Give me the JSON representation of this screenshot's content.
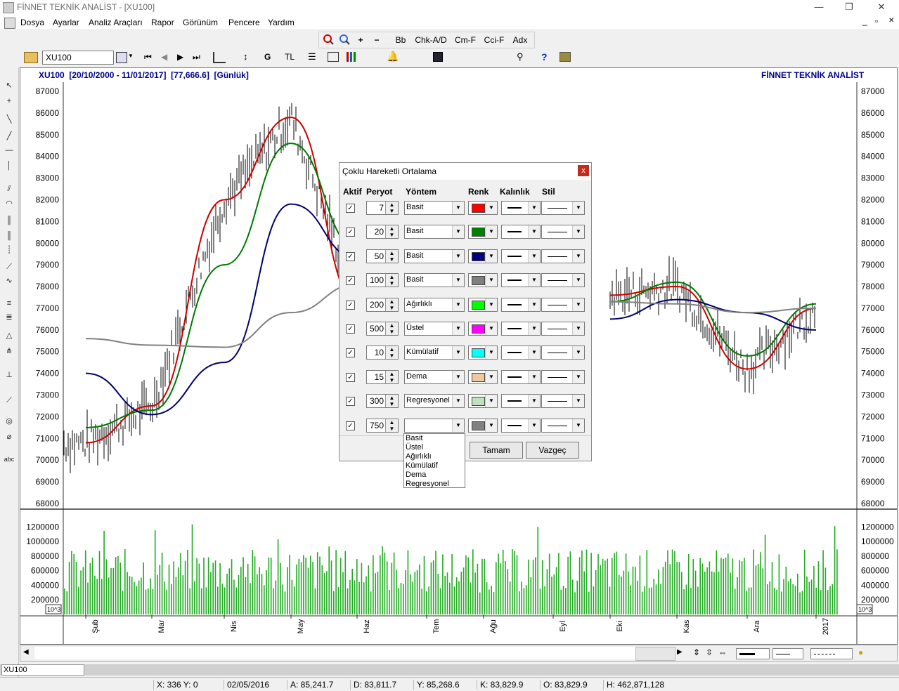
{
  "app": {
    "title": "FİNNET TEKNİK ANALİST - [XU100]"
  },
  "window_controls": {
    "minimize": "—",
    "maximize": "❐",
    "close": "✕",
    "mdi_minimize": "_",
    "mdi_restore": "▫",
    "mdi_close": "✕"
  },
  "menu": [
    "Dosya",
    "Ayarlar",
    "Analiz Araçları",
    "Rapor",
    "Görünüm",
    "Pencere",
    "Yardım"
  ],
  "toolbar1": {
    "zoom_in": "+",
    "zoom_out": "−",
    "add": "+",
    "remove": "−",
    "items": [
      "Bb",
      "Chk-A/D",
      "Cm-F",
      "Cci-F",
      "Adx"
    ]
  },
  "toolbar2": {
    "symbol": "XU100",
    "g_label": "G",
    "tl_label": "TL",
    "help": "?"
  },
  "chart": {
    "header_left": "XU100  [20/10/2000 - 11/01/2017]  [77,666.6]  [Günlük]",
    "header_right": "FİNNET TEKNİK ANALİST",
    "price_ticks": [
      "87000",
      "86000",
      "85000",
      "84000",
      "83000",
      "82000",
      "81000",
      "80000",
      "79000",
      "78000",
      "77000",
      "76000",
      "75000",
      "74000",
      "73000",
      "72000",
      "71000",
      "70000",
      "69000",
      "68000"
    ],
    "volume_ticks": [
      "1200000",
      "1000000",
      "800000",
      "600000",
      "400000",
      "200000"
    ],
    "volume_unit": "10^3",
    "months": [
      "Şub",
      "Mar",
      "Nis",
      "May",
      "Haz",
      "Tem",
      "Ağu",
      "Eyl",
      "Eki",
      "Kas",
      "Ara",
      "2017"
    ]
  },
  "chart_data": {
    "type": "line",
    "x": [
      "Şub",
      "Mar",
      "Nis",
      "May",
      "Haz",
      "Tem",
      "Ağu",
      "Eyl",
      "Eki",
      "Kas",
      "Ara",
      "2017"
    ],
    "ylim": [
      68000,
      87000
    ],
    "series": [
      {
        "name": "7",
        "color": "#d00000",
        "values": [
          70800,
          72500,
          82000,
          85800,
          77300,
          null,
          null,
          null,
          77600,
          78000,
          74200,
          77000
        ]
      },
      {
        "name": "20",
        "color": "#007800",
        "values": [
          71500,
          72300,
          79000,
          84600,
          79800,
          null,
          null,
          null,
          77300,
          78200,
          74800,
          77200
        ]
      },
      {
        "name": "50",
        "color": "#000070",
        "values": [
          74000,
          72100,
          74500,
          81800,
          79300,
          null,
          null,
          null,
          76500,
          77400,
          76800,
          76000
        ]
      },
      {
        "name": "100",
        "color": "#808080",
        "values": [
          75600,
          75300,
          75200,
          76800,
          78100,
          null,
          null,
          null,
          77300,
          77200,
          76800,
          77000
        ]
      }
    ],
    "volume_ylim": [
      0,
      1300000
    ]
  },
  "dialog": {
    "title": "Çoklu Hareketli Ortalama",
    "close": "x",
    "headers": {
      "aktif": "Aktif",
      "peryot": "Peryot",
      "yontem": "Yöntem",
      "renk": "Renk",
      "kalinlik": "Kalınlık",
      "stil": "Stil"
    },
    "rows": [
      {
        "checked": "✓",
        "period": "7",
        "method": "Basit",
        "color": "#ff0000"
      },
      {
        "checked": "✓",
        "period": "20",
        "method": "Basit",
        "color": "#008000"
      },
      {
        "checked": "✓",
        "period": "50",
        "method": "Basit",
        "color": "#000080"
      },
      {
        "checked": "✓",
        "period": "100",
        "method": "Basit",
        "color": "#808080"
      },
      {
        "checked": "✓",
        "period": "200",
        "method": "Ağırlıklı",
        "color": "#00ff00"
      },
      {
        "checked": "✓",
        "period": "500",
        "method": "Üstel",
        "color": "#ff00ff"
      },
      {
        "checked": "✓",
        "period": "10",
        "method": "Kümülatif",
        "color": "#00ffff"
      },
      {
        "checked": "✓",
        "period": "15",
        "method": "Dema",
        "color": "#f0c8a0"
      },
      {
        "checked": "✓",
        "period": "300",
        "method": "Regresyonel",
        "color": "#c0e0c0"
      },
      {
        "checked": "✓",
        "period": "750",
        "method": "",
        "color": "#808080"
      }
    ],
    "ok": "Tamam",
    "cancel": "Vazgeç",
    "dropdown_options": [
      "Basit",
      "Üstel",
      "Ağırlıklı",
      "Kümülatif",
      "Dema",
      "Regresyonel"
    ]
  },
  "tab": {
    "label": "XU100"
  },
  "status": {
    "xy": "X: 336 Y: 0",
    "date": "02/05/2016",
    "a": "A: 85,241.7",
    "d": "D: 83,811.7",
    "y": "Y: 85,268.6",
    "k": "K: 83,829.9",
    "o": "O: 83,829.9",
    "h": "H: 462,871,128"
  }
}
